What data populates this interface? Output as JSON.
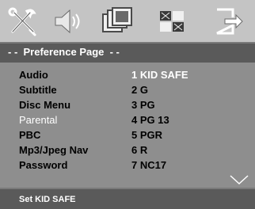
{
  "toolbar": {
    "icons": [
      "settings-tools-icon",
      "speaker-icon",
      "film-frames-icon",
      "grid-pattern-icon",
      "exit-arrow-icon"
    ]
  },
  "header": {
    "title": "- -  Preference Page  - -"
  },
  "menu": {
    "items": [
      {
        "label": "Audio",
        "option": "1 KID SAFE"
      },
      {
        "label": "Subtitle",
        "option": "2 G"
      },
      {
        "label": "Disc Menu",
        "option": "3 PG"
      },
      {
        "label": "Parental",
        "option": "4 PG 13"
      },
      {
        "label": "PBC",
        "option": "5 PGR"
      },
      {
        "label": "Mp3/Jpeg Nav",
        "option": "6 R"
      },
      {
        "label": "Password",
        "option": "7 NC17"
      }
    ],
    "active_item": "Parental",
    "selected_option": "1 KID SAFE"
  },
  "footer": {
    "status": "Set KID SAFE"
  },
  "colors": {
    "toolbar_bg": "#c4c4c4",
    "panel_bg": "#8e8e8e",
    "bar_bg": "#5a5a5a",
    "highlight": "#ffffff",
    "text": "#000000"
  }
}
